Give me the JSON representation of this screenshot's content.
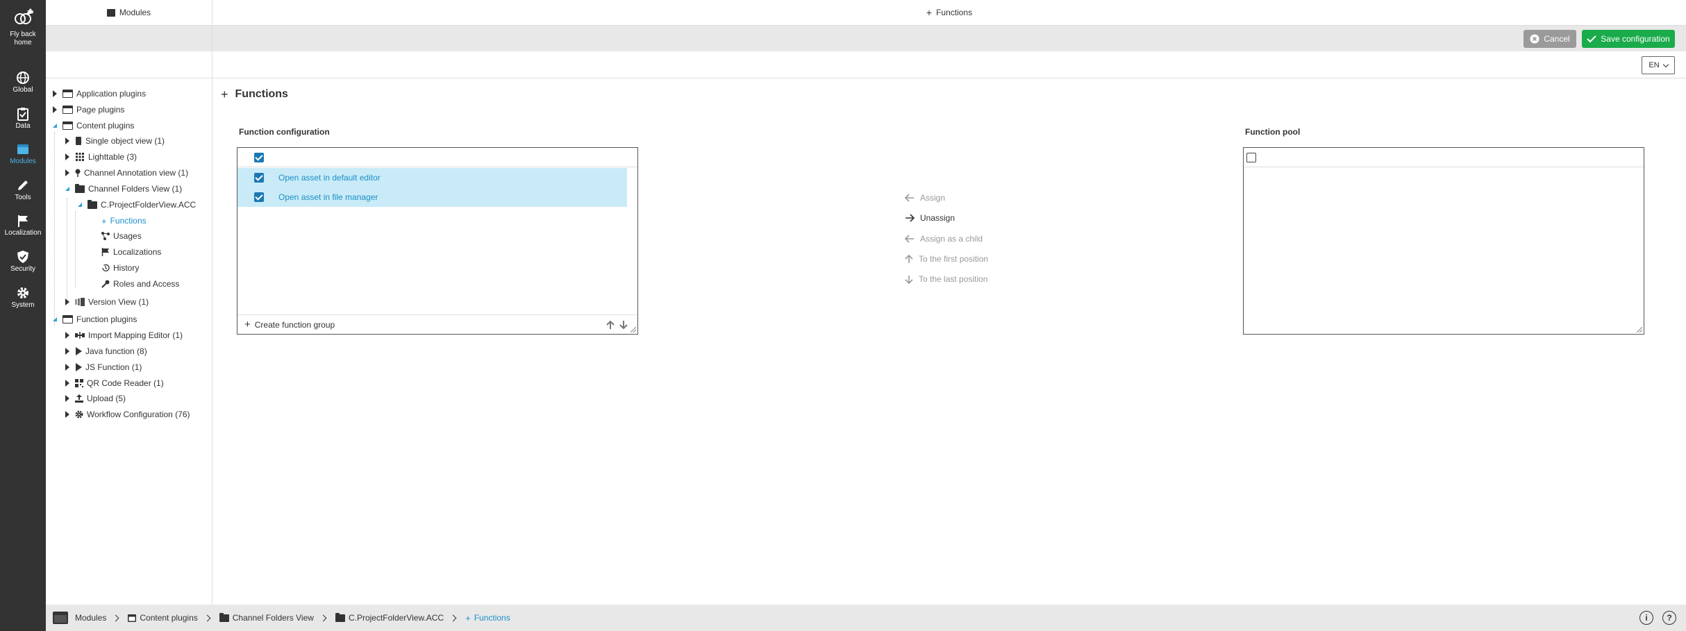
{
  "rail": {
    "items": [
      {
        "label": "Fly back home",
        "icon": "bee-logo-icon"
      },
      {
        "label": "Global",
        "icon": "globe-icon"
      },
      {
        "label": "Data",
        "icon": "clipboard-check-icon"
      },
      {
        "label": "Modules",
        "icon": "modules-icon"
      },
      {
        "label": "Tools",
        "icon": "pencil-icon"
      },
      {
        "label": "Localization",
        "icon": "flag-icon"
      },
      {
        "label": "Security",
        "icon": "shield-check-icon"
      },
      {
        "label": "System",
        "icon": "gear-icon"
      }
    ],
    "active": "Modules",
    "active_color": "#4fb3e6"
  },
  "tree": {
    "header": "Modules",
    "nodes": [
      {
        "label": "Application plugins"
      },
      {
        "label": "Page plugins"
      },
      {
        "label": "Content plugins"
      },
      {
        "label": "Single object view (1)"
      },
      {
        "label": "Lighttable (3)"
      },
      {
        "label": "Channel Annotation view (1)"
      },
      {
        "label": "Channel Folders View (1)"
      },
      {
        "label": "C.ProjectFolderView.ACC"
      },
      {
        "label": "Functions"
      },
      {
        "label": "Usages"
      },
      {
        "label": "Localizations"
      },
      {
        "label": "History"
      },
      {
        "label": "Roles and Access"
      },
      {
        "label": "Version View (1)"
      },
      {
        "label": "Function plugins"
      },
      {
        "label": "Import Mapping Editor (1)"
      },
      {
        "label": "Java function (8)"
      },
      {
        "label": "JS Function (1)"
      },
      {
        "label": "QR Code Reader (1)"
      },
      {
        "label": "Upload (5)"
      },
      {
        "label": "Workflow Configuration (76)"
      }
    ]
  },
  "header": {
    "title": "Functions"
  },
  "toolbar": {
    "cancel_label": "Cancel",
    "save_label": "Save configuration",
    "save_color": "#1aab4b",
    "language": "EN"
  },
  "main": {
    "title": "Functions",
    "config_label": "Function configuration",
    "pool_label": "Function pool",
    "config_items": [
      {
        "label": "Open asset in default editor",
        "checked": true
      },
      {
        "label": "Open asset in file manager",
        "checked": true
      }
    ],
    "create_group_label": "Create function group",
    "actions": [
      {
        "label": "Assign",
        "enabled": false
      },
      {
        "label": "Unassign",
        "enabled": true
      },
      {
        "label": "Assign as a child",
        "enabled": false
      },
      {
        "label": "To the first position",
        "enabled": false
      },
      {
        "label": "To the last position",
        "enabled": false
      }
    ]
  },
  "breadcrumb": [
    {
      "label": "Modules"
    },
    {
      "label": "Content plugins"
    },
    {
      "label": "Channel Folders View"
    },
    {
      "label": "C.ProjectFolderView.ACC"
    },
    {
      "label": "Functions"
    }
  ],
  "status": {
    "info_glyph": "i",
    "help_glyph": "?"
  }
}
